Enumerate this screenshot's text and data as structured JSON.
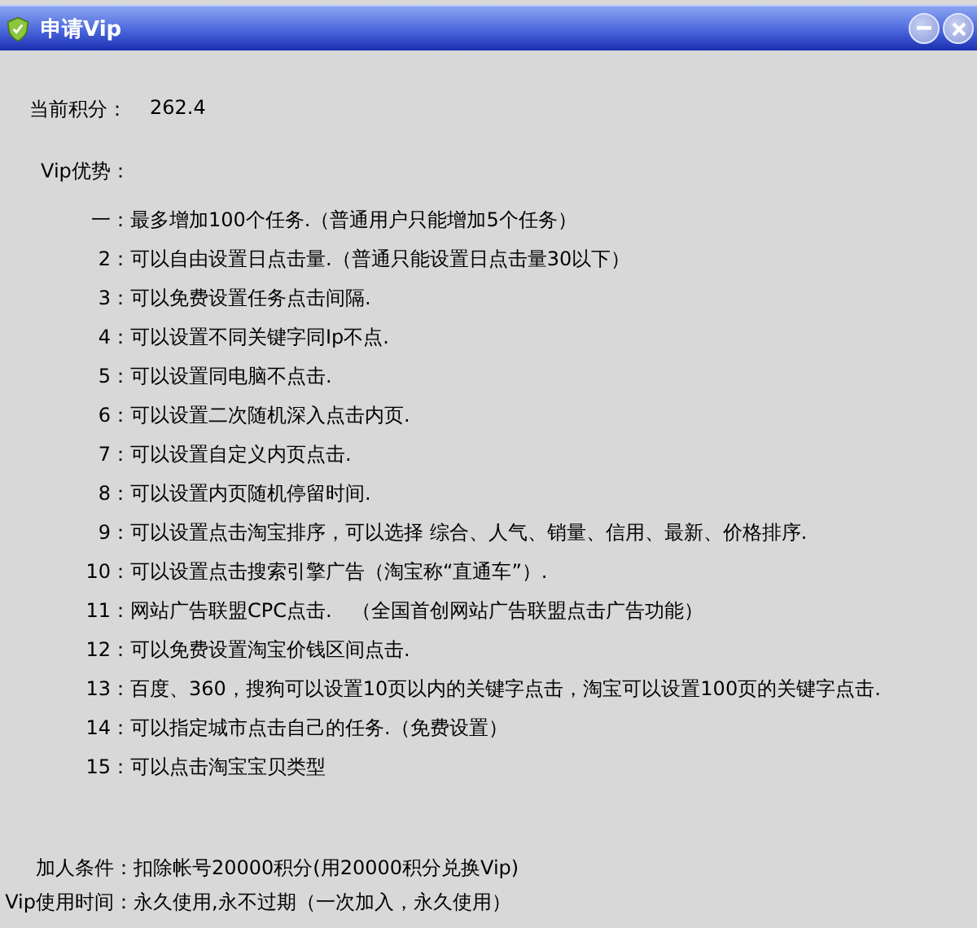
{
  "window": {
    "title": "申请Vip"
  },
  "points": {
    "label": "当前积分：",
    "value": "262.4"
  },
  "advantages": {
    "heading": "Vip优势：",
    "items": [
      {
        "number": "一：",
        "text": "最多增加100个任务.（普通用户只能增加5个任务）"
      },
      {
        "number": "2：",
        "text": "可以自由设置日点击量.（普通只能设置日点击量30以下）"
      },
      {
        "number": "3：",
        "text": "可以免费设置任务点击间隔."
      },
      {
        "number": "4：",
        "text": "可以设置不同关键字同Ip不点."
      },
      {
        "number": "5：",
        "text": "可以设置同电脑不点击."
      },
      {
        "number": "6：",
        "text": "可以设置二次随机深入点击内页."
      },
      {
        "number": "7：",
        "text": "可以设置自定义内页点击."
      },
      {
        "number": "8：",
        "text": "可以设置内页随机停留时间."
      },
      {
        "number": "9：",
        "text": "可以设置点击淘宝排序，可以选择 综合、人气、销量、信用、最新、价格排序."
      },
      {
        "number": "10：",
        "text": "可以设置点击搜索引擎广告（淘宝称“直通车”）."
      },
      {
        "number": "11：",
        "text": "网站广告联盟CPC点击.　（全国首创网站广告联盟点击广告功能）"
      },
      {
        "number": "12：",
        "text": "可以免费设置淘宝价钱区间点击."
      },
      {
        "number": "13：",
        "text": "百度、360，搜狗可以设置10页以内的关键字点击，淘宝可以设置100页的关键字点击."
      },
      {
        "number": "14：",
        "text": "可以指定城市点击自己的任务.（免费设置）"
      },
      {
        "number": "15：",
        "text": "可以点击淘宝宝贝类型"
      }
    ]
  },
  "terms": [
    {
      "label": "加人条件：",
      "value": "扣除帐号20000积分(用20000积分兑换Vip)"
    },
    {
      "label": "Vip使用时间：",
      "value": "永久使用,永不过期（一次加入，永久使用）"
    }
  ]
}
